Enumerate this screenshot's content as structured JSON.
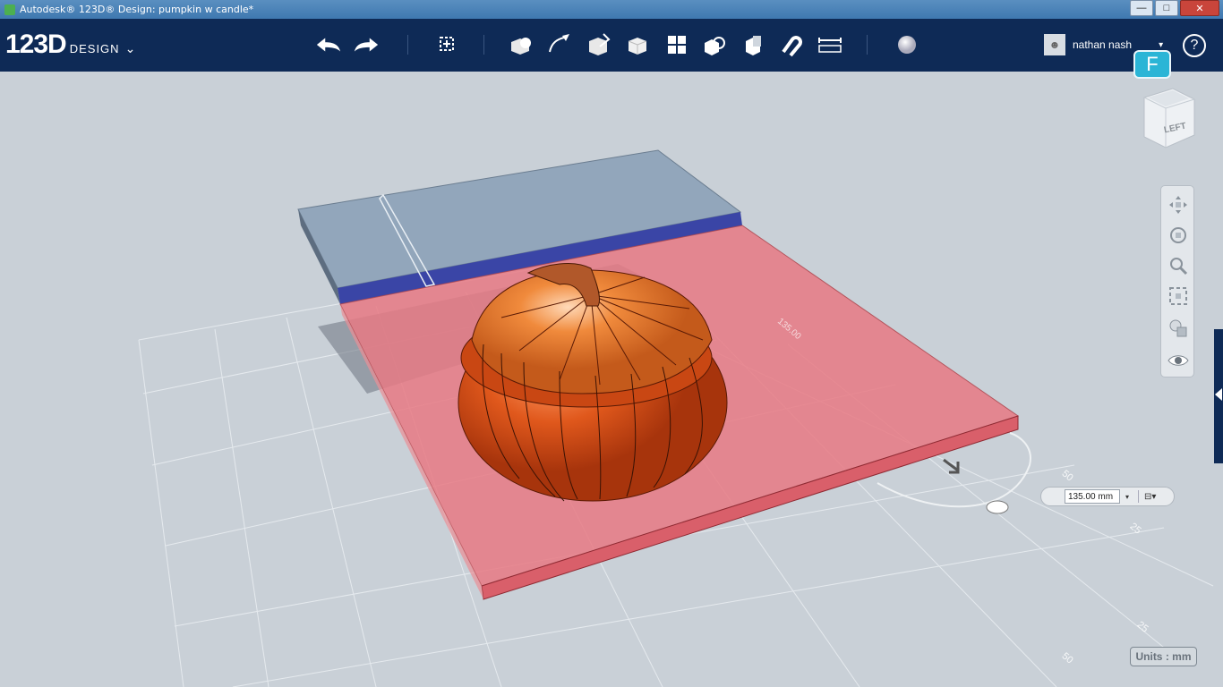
{
  "window": {
    "title": "Autodesk® 123D® Design: pumpkin w candle*",
    "buttons": {
      "minimize": "—",
      "maximize": "□",
      "close": "✕"
    }
  },
  "brand": {
    "main": "123D",
    "sub": "DESIGN",
    "chevron": "⌄"
  },
  "toolbar": {
    "tools": [
      {
        "name": "undo-icon"
      },
      {
        "name": "redo-icon"
      },
      {
        "name": "transform-icon"
      },
      {
        "name": "primitives-icon"
      },
      {
        "name": "sketch-icon"
      },
      {
        "name": "construct-icon"
      },
      {
        "name": "modify-icon"
      },
      {
        "name": "pattern-icon"
      },
      {
        "name": "group-icon"
      },
      {
        "name": "combine-icon"
      },
      {
        "name": "snap-icon"
      },
      {
        "name": "measure-icon"
      },
      {
        "name": "material-icon"
      }
    ]
  },
  "user": {
    "name": "nathan nash",
    "caret": "▾"
  },
  "help": {
    "label": "?"
  },
  "badge": {
    "label": "F"
  },
  "viewcube": {
    "face": "LEFT"
  },
  "navbar": {
    "items": [
      "pan-icon",
      "orbit-icon",
      "zoom-icon",
      "fit-icon",
      "shading-icon",
      "visibility-icon"
    ]
  },
  "dimension": {
    "value": "135.00 mm",
    "dropdown": "▾",
    "option_icon": "⊟▾"
  },
  "model_label": "135.00",
  "grid_labels": [
    "50",
    "25",
    "25",
    "50"
  ],
  "units": {
    "label": "Units : mm"
  },
  "colors": {
    "toolbar_bg": "#0e2a56",
    "viewport_bg": "#c9d0d7",
    "plate_red": "#e87a84",
    "plate_blue": "#8fa3b7",
    "edge_blue": "#3a45a6",
    "pumpkin": "#e0581c"
  }
}
